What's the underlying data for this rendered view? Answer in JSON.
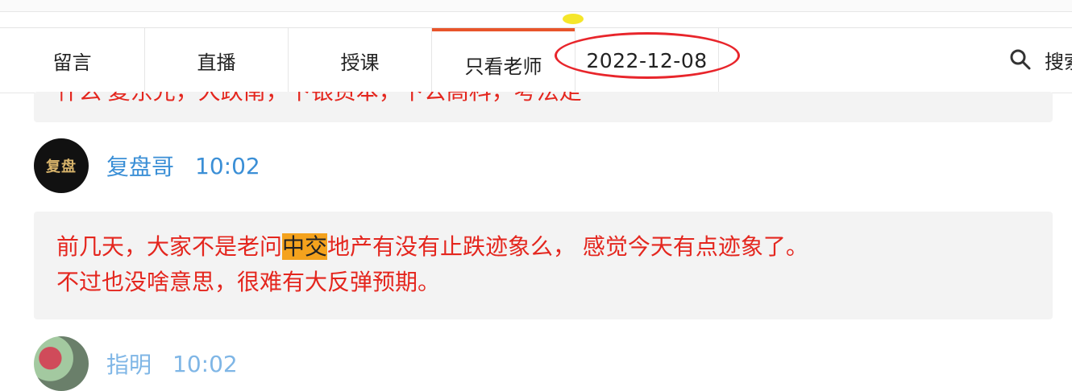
{
  "tabs": [
    {
      "label": "留言"
    },
    {
      "label": "直播"
    },
    {
      "label": "授课"
    },
    {
      "label": "只看老师",
      "active": true
    }
  ],
  "date_filter": "2022-12-08",
  "search": {
    "label": "搜索"
  },
  "messages": [
    {
      "text_partial": "什么'复东光，大跌南，下银资本，下公高科，考法走"
    },
    {
      "author": "复盘哥",
      "time": "10:02",
      "text_before": "前几天，大家不是老问",
      "highlight": "中交",
      "text_after": "地产有没有止跌迹象么，  感觉今天有点迹象了。",
      "line2": "不过也没啥意思，很难有大反弹预期。"
    },
    {
      "author": "指明",
      "time": "10:02"
    }
  ],
  "colors": {
    "accent": "#e8552b",
    "message_text": "#e4261e",
    "username": "#3b8fd6",
    "highlight": "#f4a21d",
    "annotation_ring": "#e8252b"
  },
  "icons": {
    "search": "search-icon",
    "avatar_logo": "复盘"
  }
}
